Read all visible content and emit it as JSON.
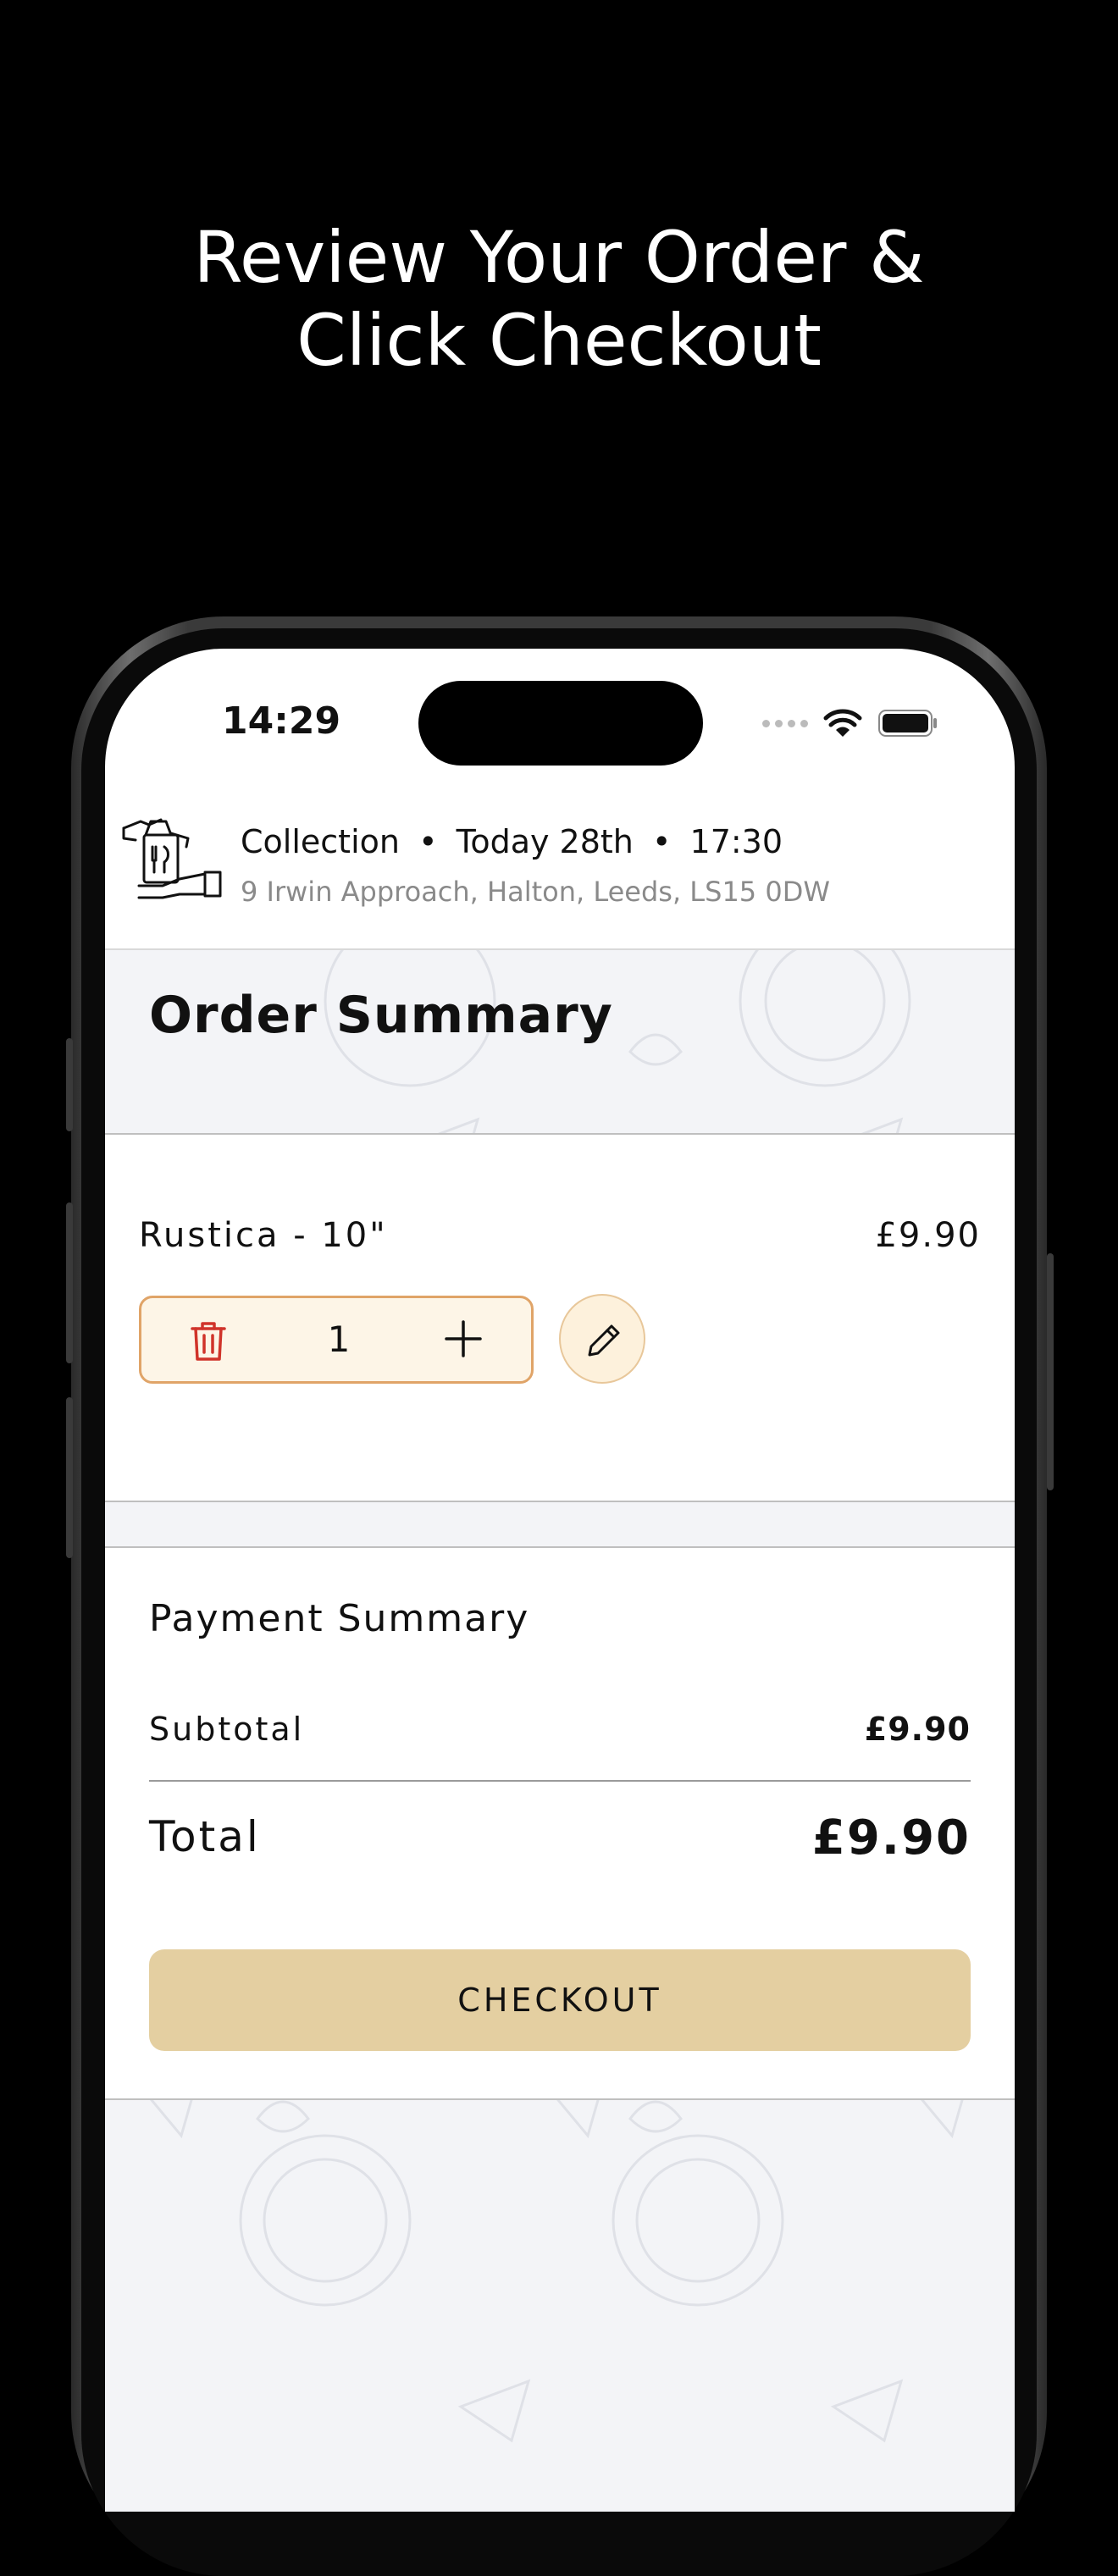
{
  "promo": {
    "line1": "Review Your Order &",
    "line2": "Click Checkout"
  },
  "status_bar": {
    "time": "14:29",
    "icons": [
      "signal-dots-icon",
      "wifi-icon",
      "battery-icon"
    ]
  },
  "header": {
    "icon": "collection-bag-icon",
    "mode": "Collection",
    "date": "Today 28th",
    "time": "17:30",
    "separator": "•",
    "address": "9 Irwin Approach, Halton, Leeds, LS15  0DW"
  },
  "order_summary": {
    "title": "Order Summary",
    "items": [
      {
        "name": "Rustica - 10\"",
        "price": "£9.90",
        "quantity": "1"
      }
    ]
  },
  "payment_summary": {
    "title": "Payment Summary",
    "subtotal_label": "Subtotal",
    "subtotal_value": "£9.90",
    "total_label": "Total",
    "total_value": "£9.90"
  },
  "checkout_label": "CHECKOUT",
  "colors": {
    "accent_button": "#e4cfa1",
    "stepper_border": "#e0a468",
    "stepper_bg": "#fdf5e7",
    "trash_icon": "#d0332a",
    "pattern_bg": "#f3f4f7"
  }
}
